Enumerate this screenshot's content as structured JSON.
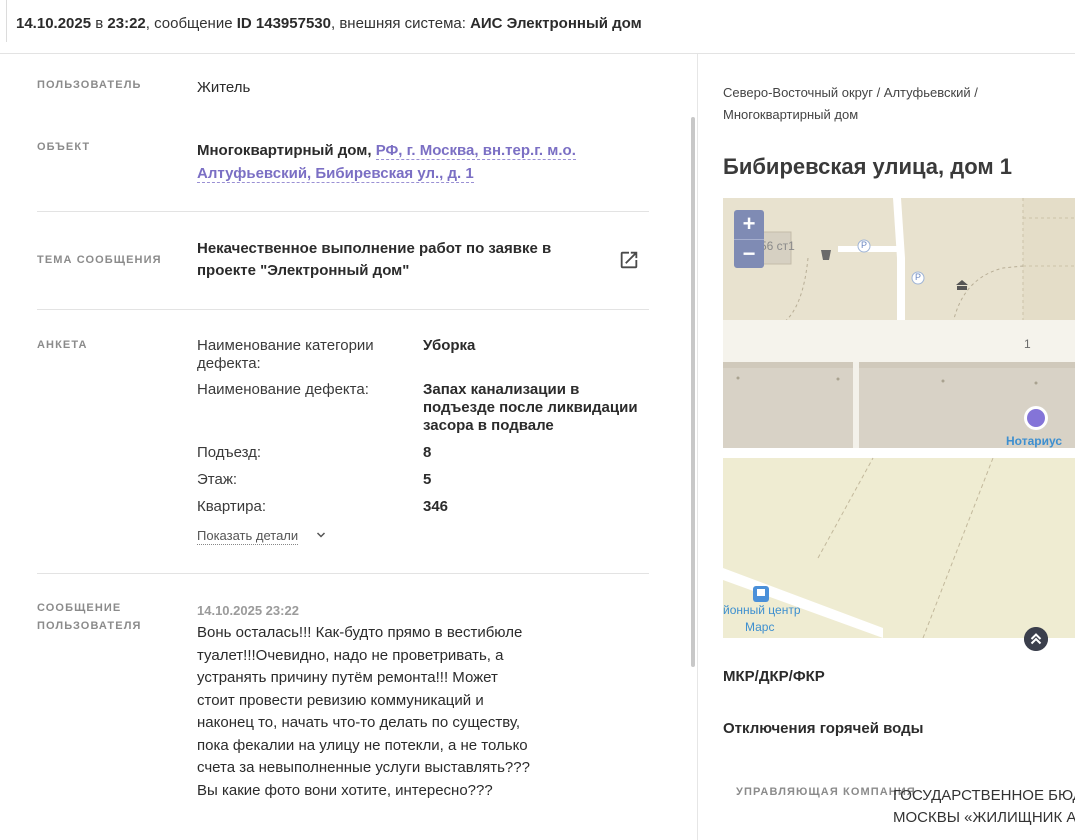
{
  "header": {
    "date": "14.10.2025",
    "in_word": " в ",
    "time": "23:22",
    "msg_prefix": ", сообщение ",
    "msg_id": "ID 143957530",
    "sys_prefix": ", внешняя система: ",
    "system": "АИС Электронный дом"
  },
  "user": {
    "label": "Пользователь",
    "value": "Житель"
  },
  "object": {
    "label": "Объект",
    "type": "Многоквартирный дом, ",
    "address_link": "РФ, г. Москва, вн.тер.г. м.о. Алтуфьевский, Бибиревская ул., д. 1"
  },
  "topic": {
    "label": "Тема сообщения",
    "value": "Некачественное выполнение работ по заявке в проекте \"Электронный дом\"",
    "icon": "external-link-icon"
  },
  "survey": {
    "label": "Анкета",
    "rows": [
      {
        "q": "Наименование категории дефекта:",
        "a": "Уборка"
      },
      {
        "q": "Наименование дефекта:",
        "a": "Запах канализации в подъезде после ликвидации засора в подвале"
      },
      {
        "q": "Подъезд:",
        "a": "8"
      },
      {
        "q": "Этаж:",
        "a": "5"
      },
      {
        "q": "Квартира:",
        "a": "346"
      }
    ],
    "details_label": "Показать детали"
  },
  "message": {
    "label": "Сообщение пользователя",
    "date": "14.10.2025 23:22",
    "text": "Вонь осталась!!! Как-будто прямо в вестибюле туалет!!!Очевидно, надо не проветривать, а устранять причину путём ремонта!!! Может стоит провести ревизию коммуникаций и наконец то, начать что-то делать по существу, пока фекалии на улицу не потекли, а не только счета за невыполненные услуги выставлять??? Вы какие фото вони хотите, интересно???"
  },
  "right": {
    "breadcrumb": "Северо-Восточный округ / Алтуфьевский / Многоквартирный дом",
    "address": "Бибиревская улица, дом 1",
    "map": {
      "zoom_in": "+",
      "zoom_out": "−",
      "label_building": "56 ст1",
      "label_house_no": "1",
      "label_notary": "Нотариус",
      "label_center": "йонный центр",
      "label_mars": "Марс",
      "parking": "P"
    },
    "section_mkr": "МКР/ДКР/ФКР",
    "section_hot_water": "Отключения горячей воды",
    "mc_label": "Управляющая компания",
    "mc_value_1": "ГОСУДАРСТВЕННОЕ БЮДЖ",
    "mc_value_2": "МОСКВЫ «ЖИЛИЩНИК А."
  },
  "colors": {
    "link": "#7b6fc4",
    "label": "#8b8b8b",
    "zoom": "#7f8bb4",
    "marker": "#8474d8"
  }
}
